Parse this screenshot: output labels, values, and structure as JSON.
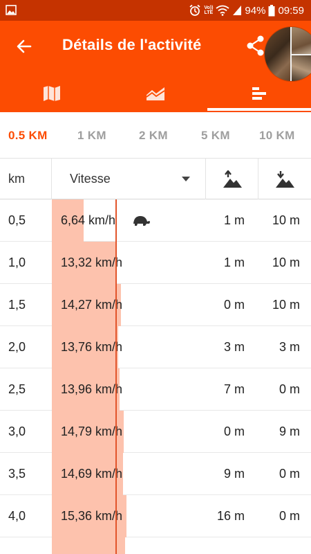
{
  "status_bar": {
    "battery": "94%",
    "time": "09:59",
    "network_top": "Vo))",
    "network_bottom": "LTE"
  },
  "header": {
    "title": "Détails de l'activité"
  },
  "tabs": {
    "icons": [
      "map-icon",
      "chart-icon",
      "splits-icon"
    ],
    "active_index": 2
  },
  "distance_tabs": [
    "0.5 KM",
    "1 KM",
    "2 KM",
    "5 KM",
    "10 KM"
  ],
  "distance_tab_active": "0.5 KM",
  "table": {
    "headers": {
      "km": "km",
      "speed": "Vitesse",
      "elev_up_icon": "elevation-gain-icon",
      "elev_down_icon": "elevation-loss-icon"
    },
    "rows": [
      {
        "km": "0,5",
        "speed": "6,64 km/h",
        "speed_value": 6.64,
        "up": "1 m",
        "down": "10 m",
        "slowest": true
      },
      {
        "km": "1,0",
        "speed": "13,32 km/h",
        "speed_value": 13.32,
        "up": "1 m",
        "down": "10 m"
      },
      {
        "km": "1,5",
        "speed": "14,27 km/h",
        "speed_value": 14.27,
        "up": "0 m",
        "down": "10 m"
      },
      {
        "km": "2,0",
        "speed": "13,76 km/h",
        "speed_value": 13.76,
        "up": "3 m",
        "down": "3 m"
      },
      {
        "km": "2,5",
        "speed": "13,96 km/h",
        "speed_value": 13.96,
        "up": "7 m",
        "down": "0 m"
      },
      {
        "km": "3,0",
        "speed": "14,79 km/h",
        "speed_value": 14.79,
        "up": "0 m",
        "down": "9 m"
      },
      {
        "km": "3,5",
        "speed": "14,69 km/h",
        "speed_value": 14.69,
        "up": "9 m",
        "down": "0 m"
      },
      {
        "km": "4,0",
        "speed": "15,36 km/h",
        "speed_value": 15.36,
        "up": "16 m",
        "down": "0 m"
      },
      {
        "km": "",
        "speed": "",
        "speed_value": 15.1,
        "up": "",
        "down": ""
      }
    ],
    "average_speed": 13.2,
    "slowest_icon": "turtle-icon"
  },
  "colors": {
    "brand": "#fc4c02",
    "status_bar": "#c53300",
    "bar_fill": "#fdc2ad",
    "average_line": "#e2542a",
    "inactive_tab_text": "#9e9e9e"
  }
}
